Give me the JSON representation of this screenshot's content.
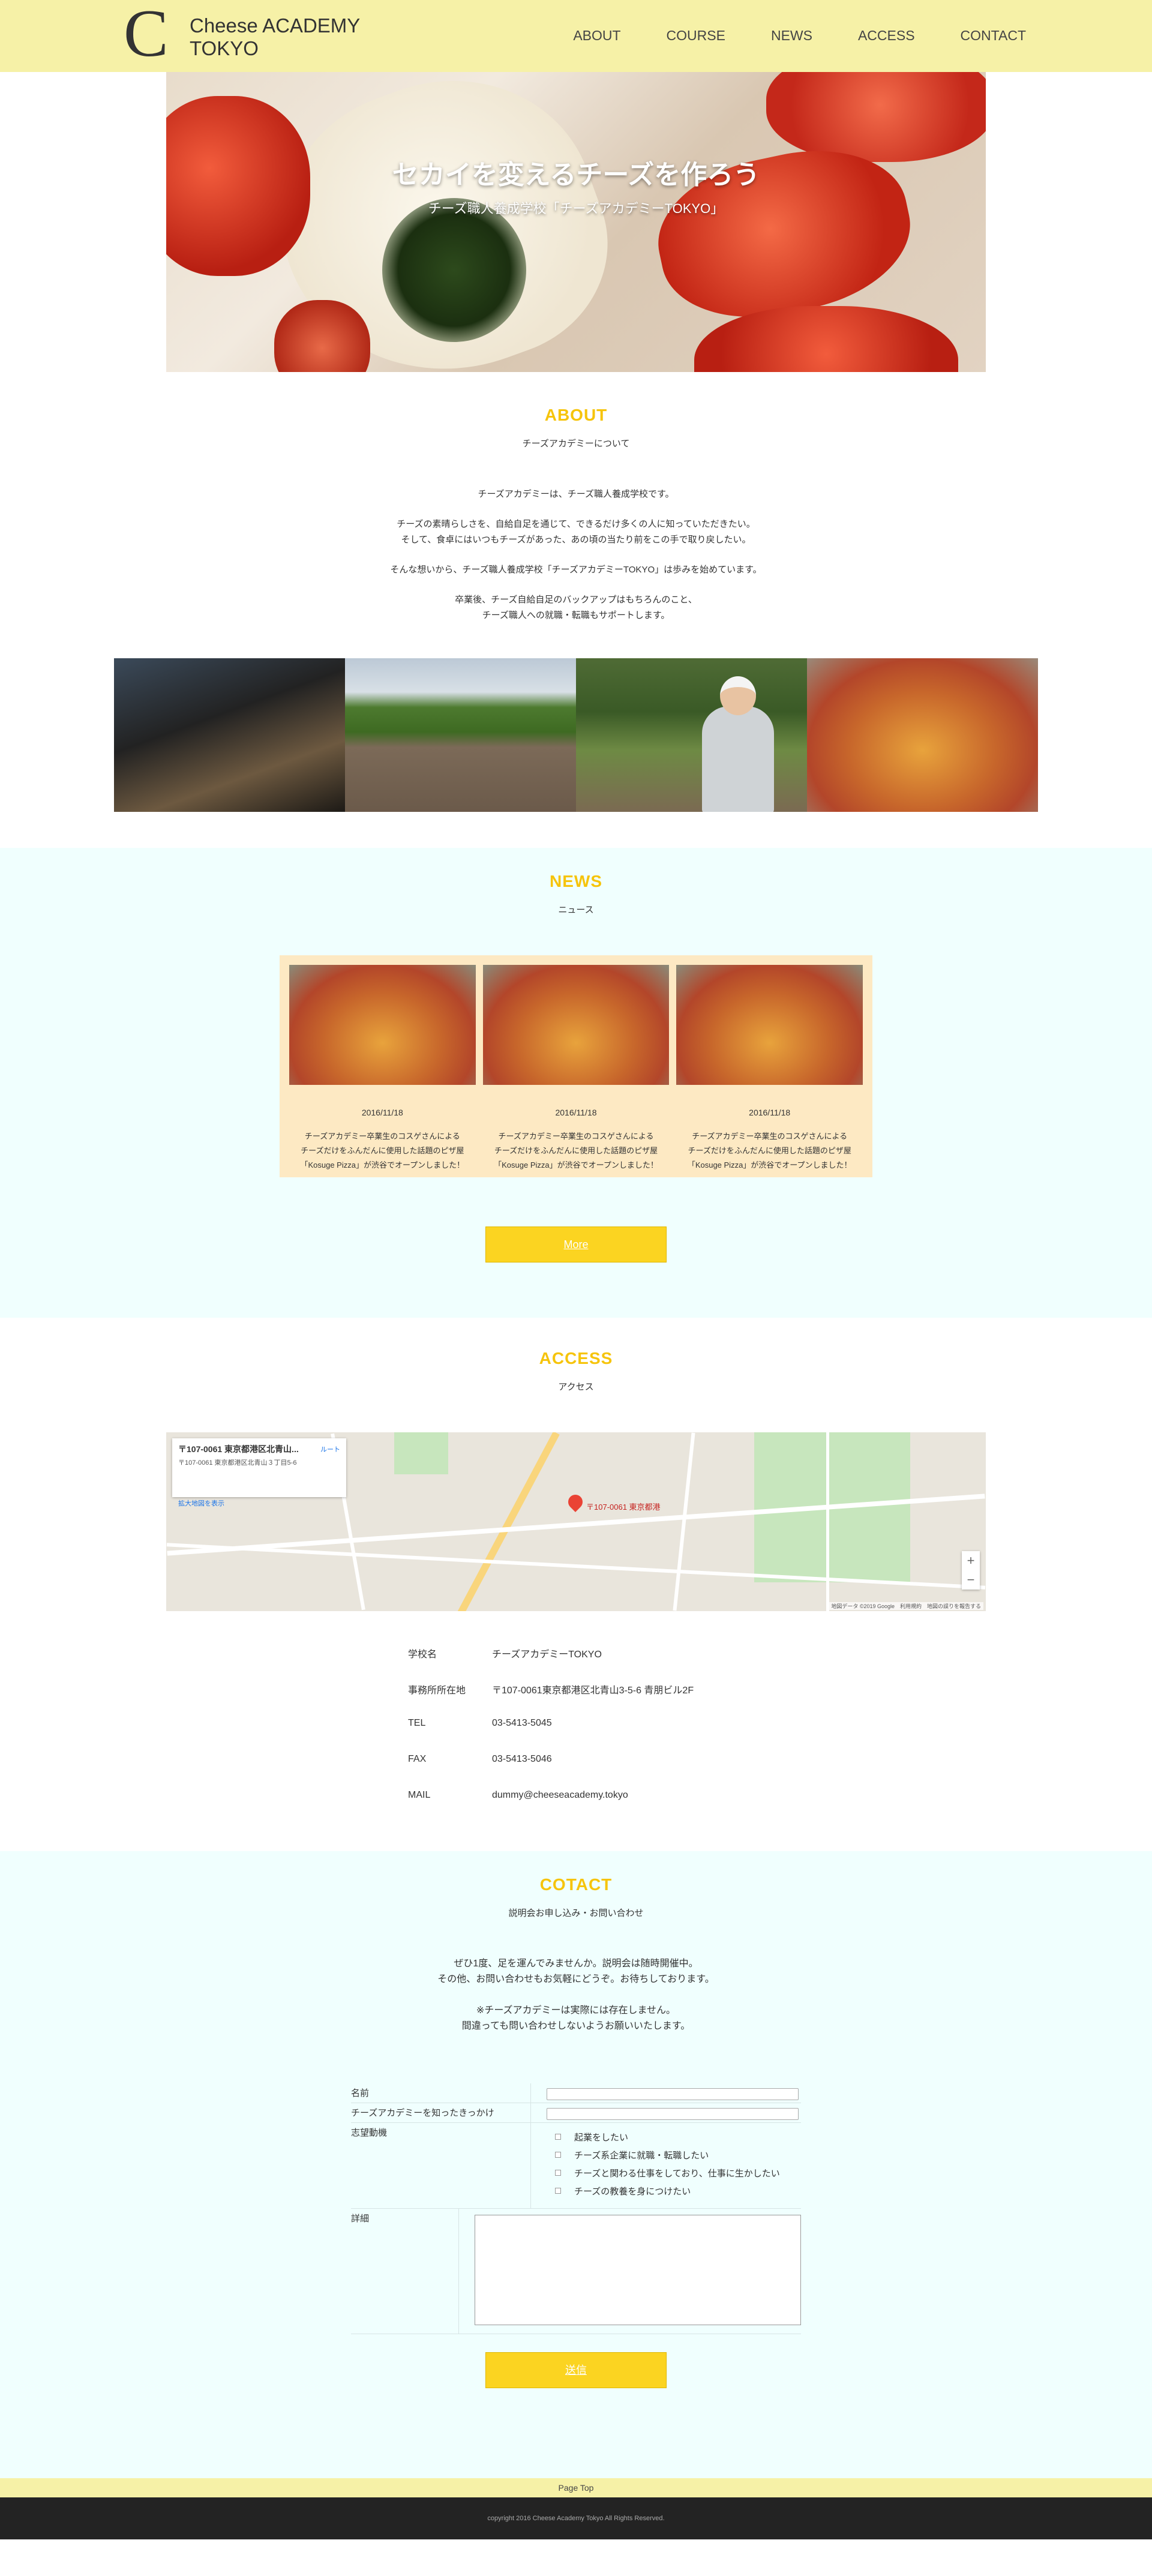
{
  "header": {
    "logo_mark": "C",
    "logo_line1": "Cheese ACADEMY",
    "logo_line2": "TOKYO",
    "nav": [
      "ABOUT",
      "COURSE",
      "NEWS",
      "ACCESS",
      "CONTACT"
    ]
  },
  "hero": {
    "title": "セカイを変えるチーズを作ろう",
    "subtitle": "チーズ職人養成学校「チーズアカデミーTOKYO」"
  },
  "about": {
    "title": "ABOUT",
    "subtitle": "チーズアカデミーについて",
    "paragraphs": [
      [
        "チーズアカデミーは、チーズ職人養成学校です。"
      ],
      [
        "チーズの素晴らしさを、自給自足を通じて、できるだけ多くの人に知っていただきたい。",
        "そして、食卓にはいつもチーズがあった、あの頃の当たり前をこの手で取り戻したい。"
      ],
      [
        "そんな想いから、チーズ職人養成学校「チーズアカデミーTOKYO」は歩みを始めています。"
      ],
      [
        "卒業後、チーズ自給自足のバックアップはもちろんのこと、",
        "チーズ職人への就職・転職もサポートします。"
      ]
    ]
  },
  "news": {
    "title": "NEWS",
    "subtitle": "ニュース",
    "items": [
      {
        "date": "2016/11/18",
        "lines": [
          "チーズアカデミー卒業生のコスゲさんによる",
          "チーズだけをふんだんに使用した話題のピザ屋",
          "「Kosuge Pizza」が渋谷でオープンしました！"
        ]
      },
      {
        "date": "2016/11/18",
        "lines": [
          "チーズアカデミー卒業生のコスゲさんによる",
          "チーズだけをふんだんに使用した話題のピザ屋",
          "「Kosuge Pizza」が渋谷でオープンしました！"
        ]
      },
      {
        "date": "2016/11/18",
        "lines": [
          "チーズアカデミー卒業生のコスゲさんによる",
          "チーズだけをふんだんに使用した話題のピザ屋",
          "「Kosuge Pizza」が渋谷でオープンしました！"
        ]
      }
    ],
    "more_label": "More"
  },
  "access": {
    "title": "ACCESS",
    "subtitle": "アクセス",
    "map": {
      "card_title": "〒107-0061 東京都港区北青山...",
      "card_addr": "〒107-0061 東京都港区北青山３丁目5-6",
      "card_link": "拡大地図を表示",
      "route": "ルート",
      "pin_label": "〒107-0061 東京都港",
      "zoom_in": "+",
      "zoom_out": "−",
      "footer": "地図データ ©2019 Google　利用規約　地図の誤りを報告する"
    },
    "info": [
      {
        "k": "学校名",
        "v": "チーズアカデミーTOKYO"
      },
      {
        "k": "事務所所在地",
        "v": "〒107-0061東京都港区北青山3-5-6 青朋ビル2F"
      },
      {
        "k": "TEL",
        "v": "03-5413-5045"
      },
      {
        "k": "FAX",
        "v": "03-5413-5046"
      },
      {
        "k": "MAIL",
        "v": "dummy@cheeseacademy.tokyo"
      }
    ]
  },
  "contact": {
    "title": "COTACT",
    "subtitle": "説明会お申し込み・お問い合わせ",
    "paragraphs": [
      [
        "ぜひ1度、足を運んでみませんか。説明会は随時開催中。",
        "その他、お問い合わせもお気軽にどうぞ。お待ちしております。"
      ],
      [
        "※チーズアカデミーは実際には存在しません。",
        "間違っても問い合わせしないようお願いいたします。"
      ]
    ],
    "form": {
      "name_label": "名前",
      "trigger_label": "チーズアカデミーを知ったきっかけ",
      "motive_label": "志望動機",
      "motives": [
        "起業をしたい",
        "チーズ系企業に就職・転職したい",
        "チーズと関わる仕事をしており、仕事に生かしたい",
        "チーズの教養を身につけたい"
      ],
      "detail_label": "詳細",
      "submit_label": "送信"
    }
  },
  "footer": {
    "pagetop": "Page Top",
    "copyright": "copyright 2016 Cheese Academy Tokyo All Rights Reserved."
  },
  "colors": {
    "header_bg": "#f6f1a7",
    "accent": "#f6c40b",
    "button": "#fbd421",
    "section_bg": "#f0fffe",
    "news_card_bg": "#fde9c3",
    "footer_bg": "#232323"
  }
}
